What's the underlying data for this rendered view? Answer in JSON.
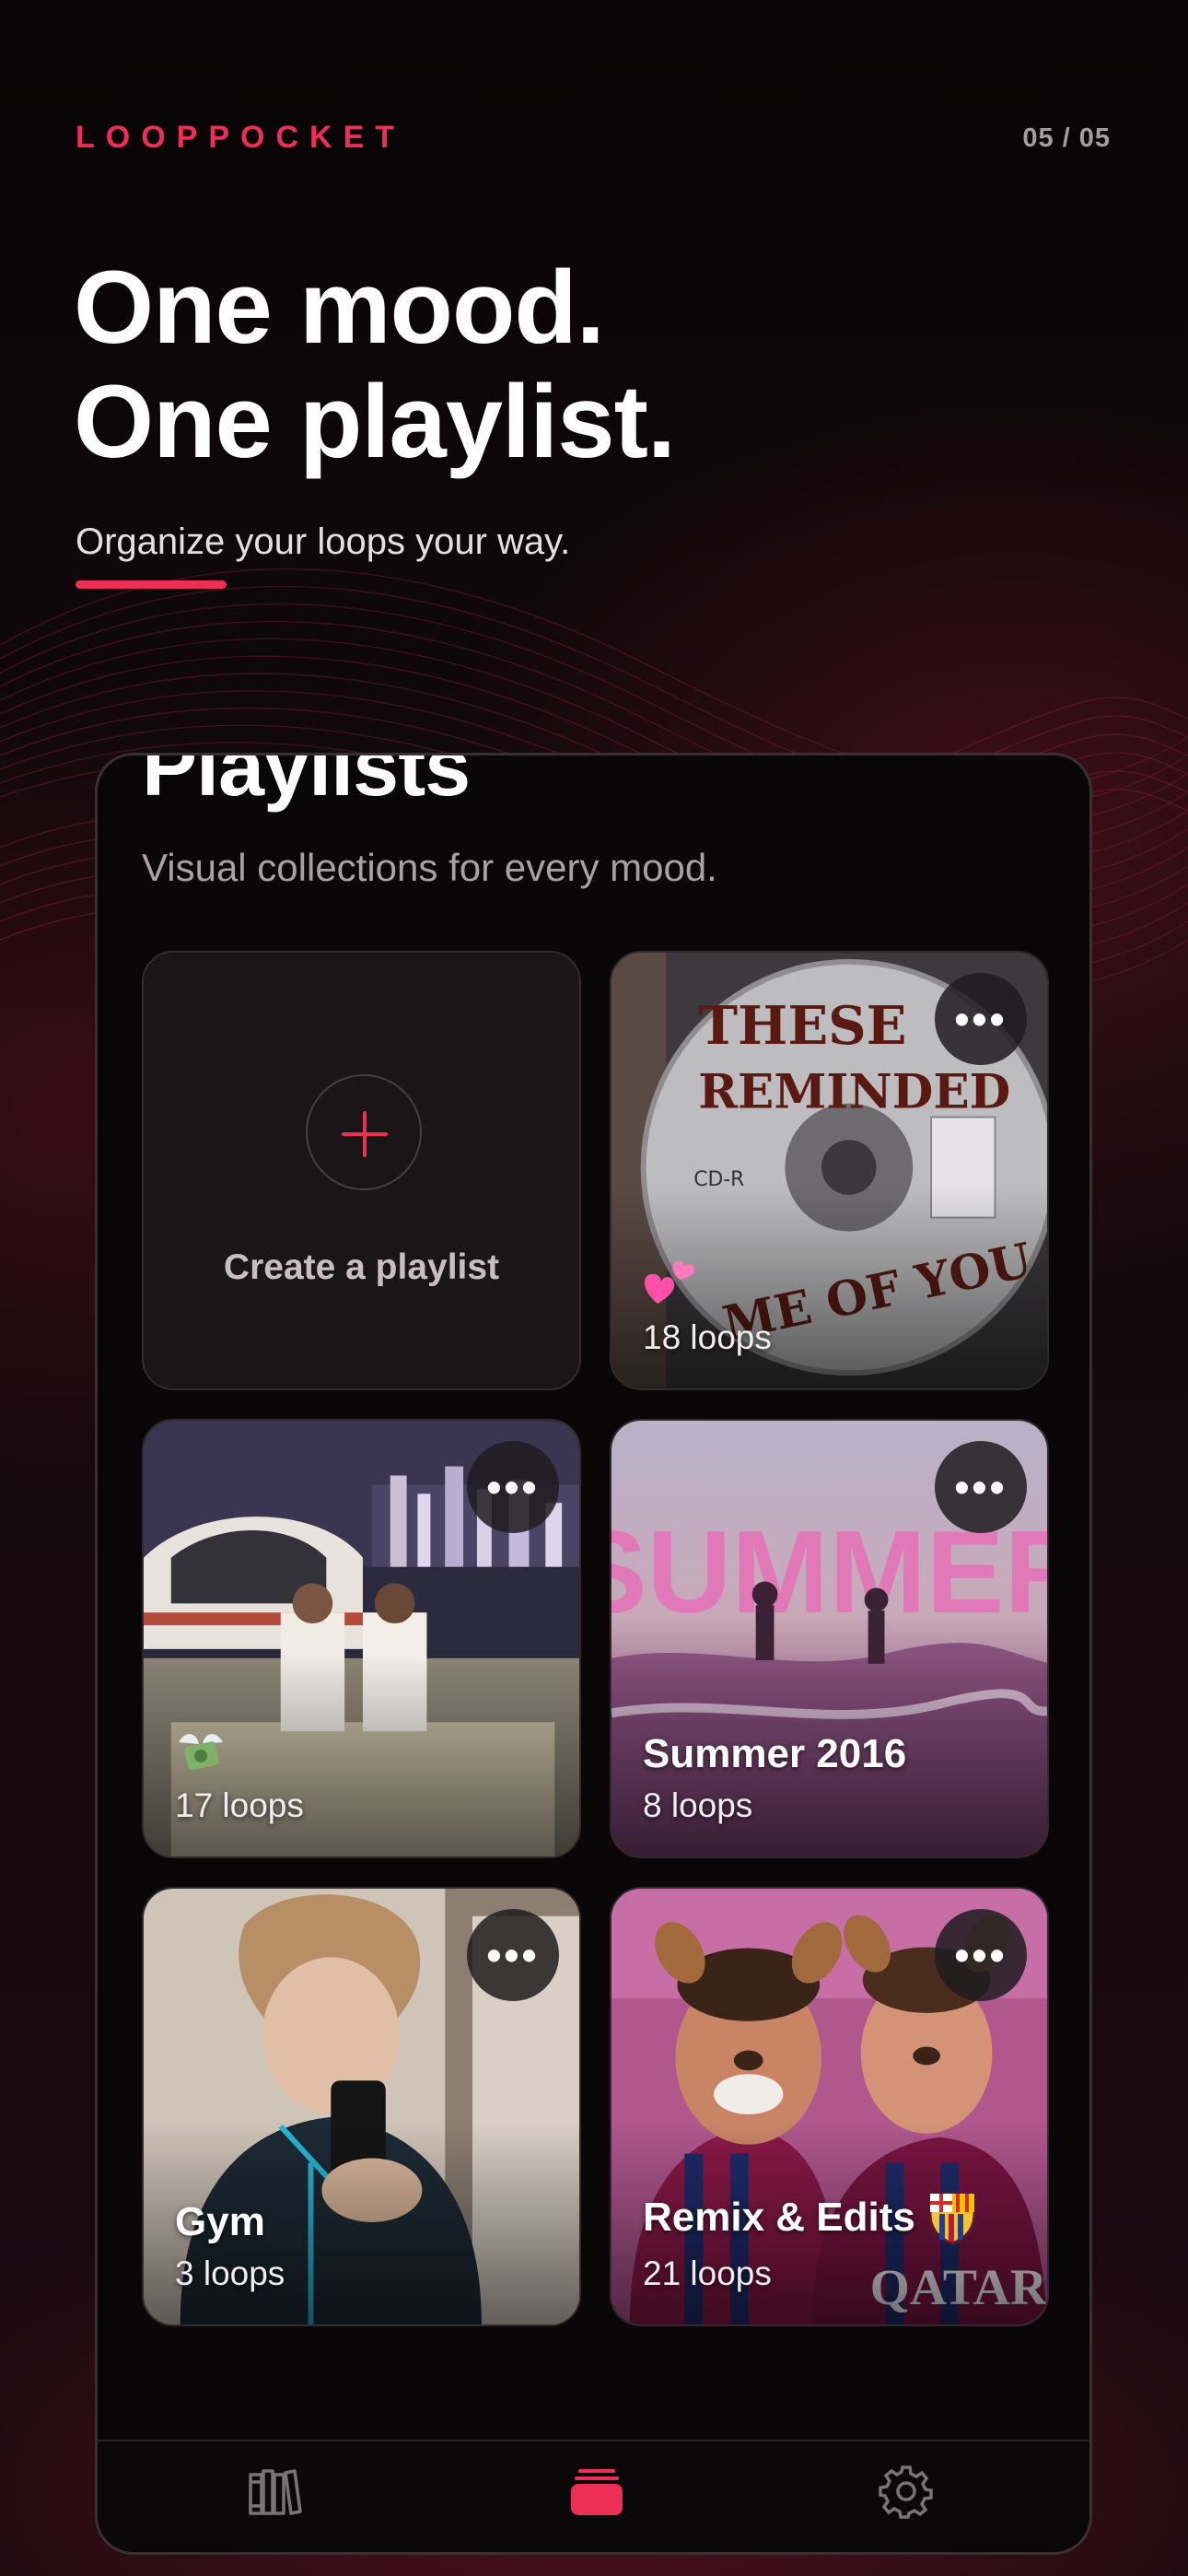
{
  "brand": "LOOPPOCKET",
  "pager": "05 / 05",
  "headline": {
    "line1": "One mood.",
    "line2": "One playlist."
  },
  "subhead": "Organize your loops your way.",
  "colors": {
    "accent": "#ee2f55",
    "background": "#0c0809",
    "card": "#1a1517"
  },
  "screen": {
    "title": "Playlists",
    "subtitle": "Visual collections for every mood.",
    "create_label": "Create a playlist",
    "more_label": "•••",
    "playlists": [
      {
        "name": "",
        "emoji": "hearts",
        "count": "18 loops",
        "art": "cd-these-reminded-me-of-you"
      },
      {
        "name": "",
        "emoji": "money-with-wings",
        "count": "17 loops",
        "art": "helicopter-money"
      },
      {
        "name": "Summer 2016",
        "count": "8 loops",
        "art": "summer-beach"
      },
      {
        "name": "Gym",
        "count": "3 loops",
        "art": "mirror-selfie"
      },
      {
        "name": "Remix & Edits",
        "emoji": "fc-barcelona-crest",
        "count": "21 loops",
        "art": "football-players"
      }
    ]
  },
  "tabbar": {
    "items": [
      {
        "icon": "library-icon",
        "active": false
      },
      {
        "icon": "playlists-icon",
        "active": true
      },
      {
        "icon": "gear-icon",
        "active": false
      }
    ]
  }
}
